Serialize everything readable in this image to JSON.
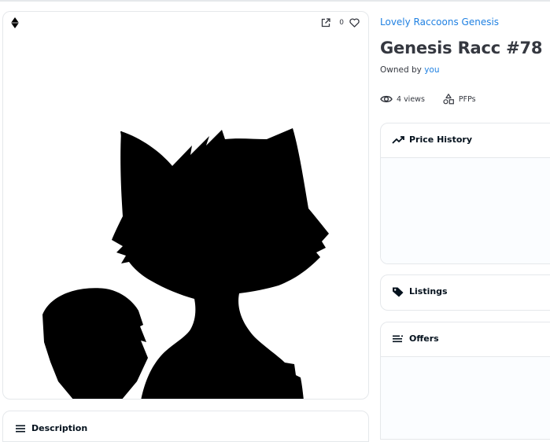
{
  "asset": {
    "favorite_count": "0"
  },
  "collection": {
    "name": "Lovely Raccoons Genesis"
  },
  "item": {
    "title": "Genesis Racc #78",
    "owned_by_label": "Owned by",
    "owner": "you"
  },
  "stats": {
    "views": "4 views",
    "category": "PFPs"
  },
  "panels": {
    "price_history": "Price History",
    "listings": "Listings",
    "offers": "Offers",
    "description": "Description"
  },
  "icons": {
    "chain": "ethereum-icon",
    "share": "external-link-icon",
    "favorite": "heart-icon",
    "views": "eye-icon",
    "category": "shapes-icon",
    "price_history": "trending-up-icon",
    "listings": "tag-icon",
    "offers": "list-icon",
    "description": "list-icon"
  },
  "colors": {
    "link": "#2081e2",
    "text": "#353840",
    "border": "#e5e8eb"
  }
}
